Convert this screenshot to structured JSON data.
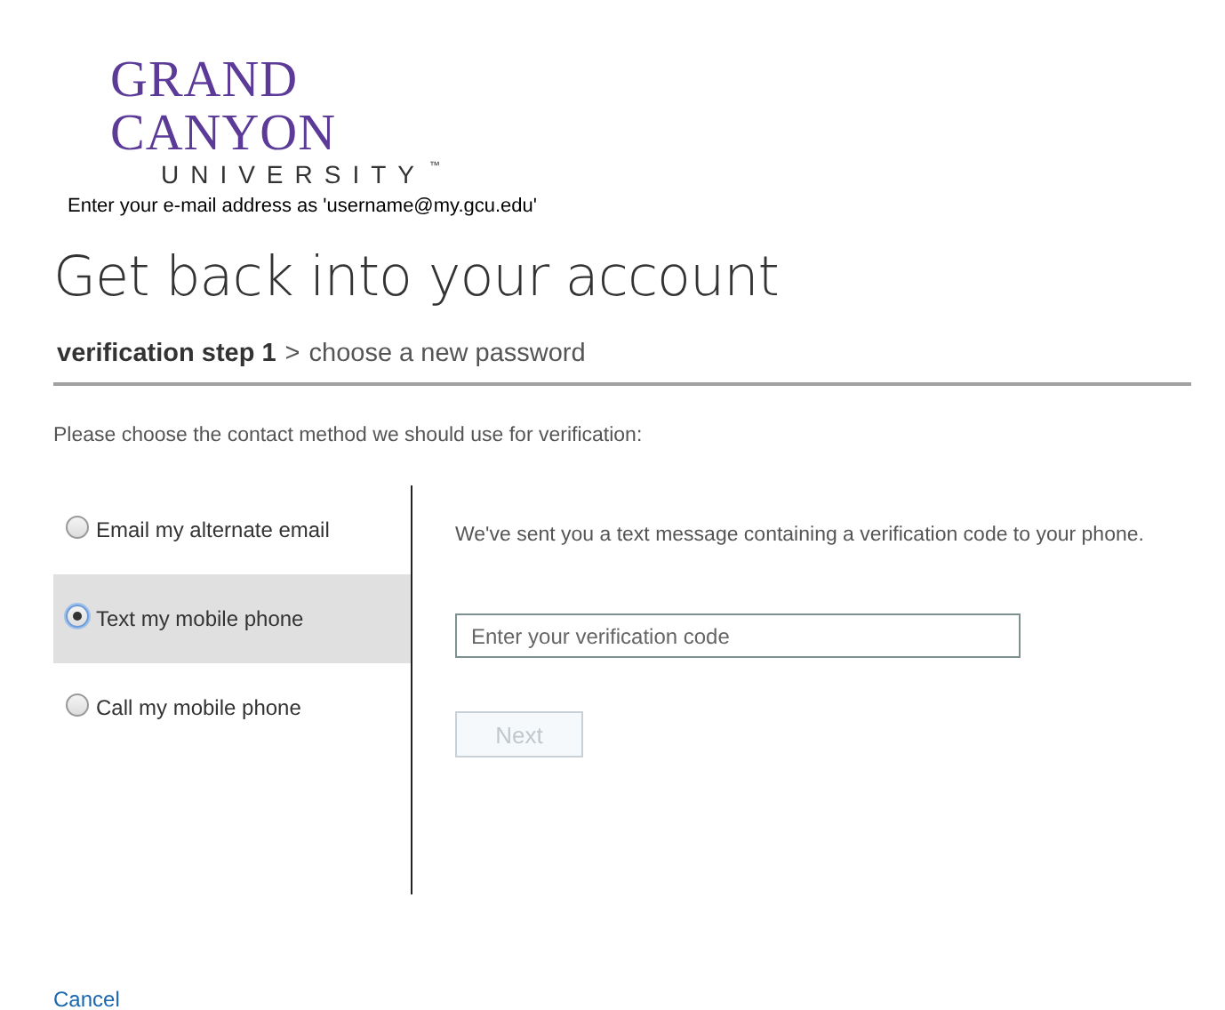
{
  "logo": {
    "name": "GRAND CANYON",
    "sub": "UNIVERSITY",
    "mark": "™"
  },
  "notice": "Enter your e-mail address as 'username@my.gcu.edu'",
  "heading": "Get back into your account",
  "steps": {
    "current": "verification step 1",
    "separator": ">",
    "next": "choose a new password"
  },
  "instruction": "Please choose the contact method we should use for verification:",
  "methods": [
    {
      "label": "Email my alternate email",
      "selected": false
    },
    {
      "label": "Text my mobile phone",
      "selected": true
    },
    {
      "label": "Call my mobile phone",
      "selected": false
    }
  ],
  "message": "We've sent you a text message containing a verification code to your phone.",
  "code_field": {
    "placeholder": "Enter your verification code"
  },
  "next_button": {
    "label": "Next",
    "disabled": true
  },
  "cancel": "Cancel"
}
